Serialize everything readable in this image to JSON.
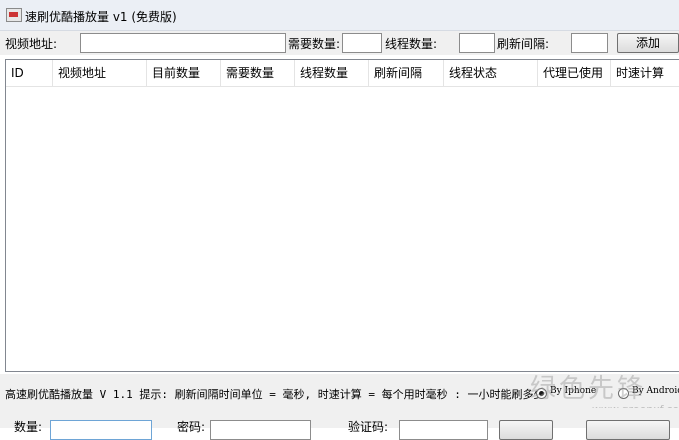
{
  "window": {
    "title": "速刷优酷播放量 v1 (免费版)"
  },
  "toolbar": {
    "video_url_label": "视频地址:",
    "video_url_value": "",
    "need_count_label": "需要数量:",
    "need_count_value": "",
    "thread_count_label": "线程数量:",
    "thread_count_value": "",
    "refresh_interval_label": "刷新间隔:",
    "refresh_interval_value": "",
    "add_label": "添加"
  },
  "table": {
    "columns": [
      "ID",
      "视频地址",
      "目前数量",
      "需要数量",
      "线程数量",
      "刷新间隔",
      "线程状态",
      "代理已使用",
      "时速计算"
    ],
    "rows": []
  },
  "status": {
    "text": "高速刷优酷播放量 V 1.1  提示: 刷新间隔时间单位 = 毫秒, 时速计算 = 每个用时毫秒 : 一小时能刷多少",
    "radio_iphone": "By Iphone",
    "radio_android": "By Android",
    "selected": "By Iphone"
  },
  "watermark": {
    "text": "绿色先锋",
    "url": "www.greenxf.com"
  },
  "bottom": {
    "count_label": "数量:",
    "count_value": "",
    "password_label": "密码:",
    "password_value": "",
    "verify_label": "验证码:",
    "verify_value": ""
  }
}
